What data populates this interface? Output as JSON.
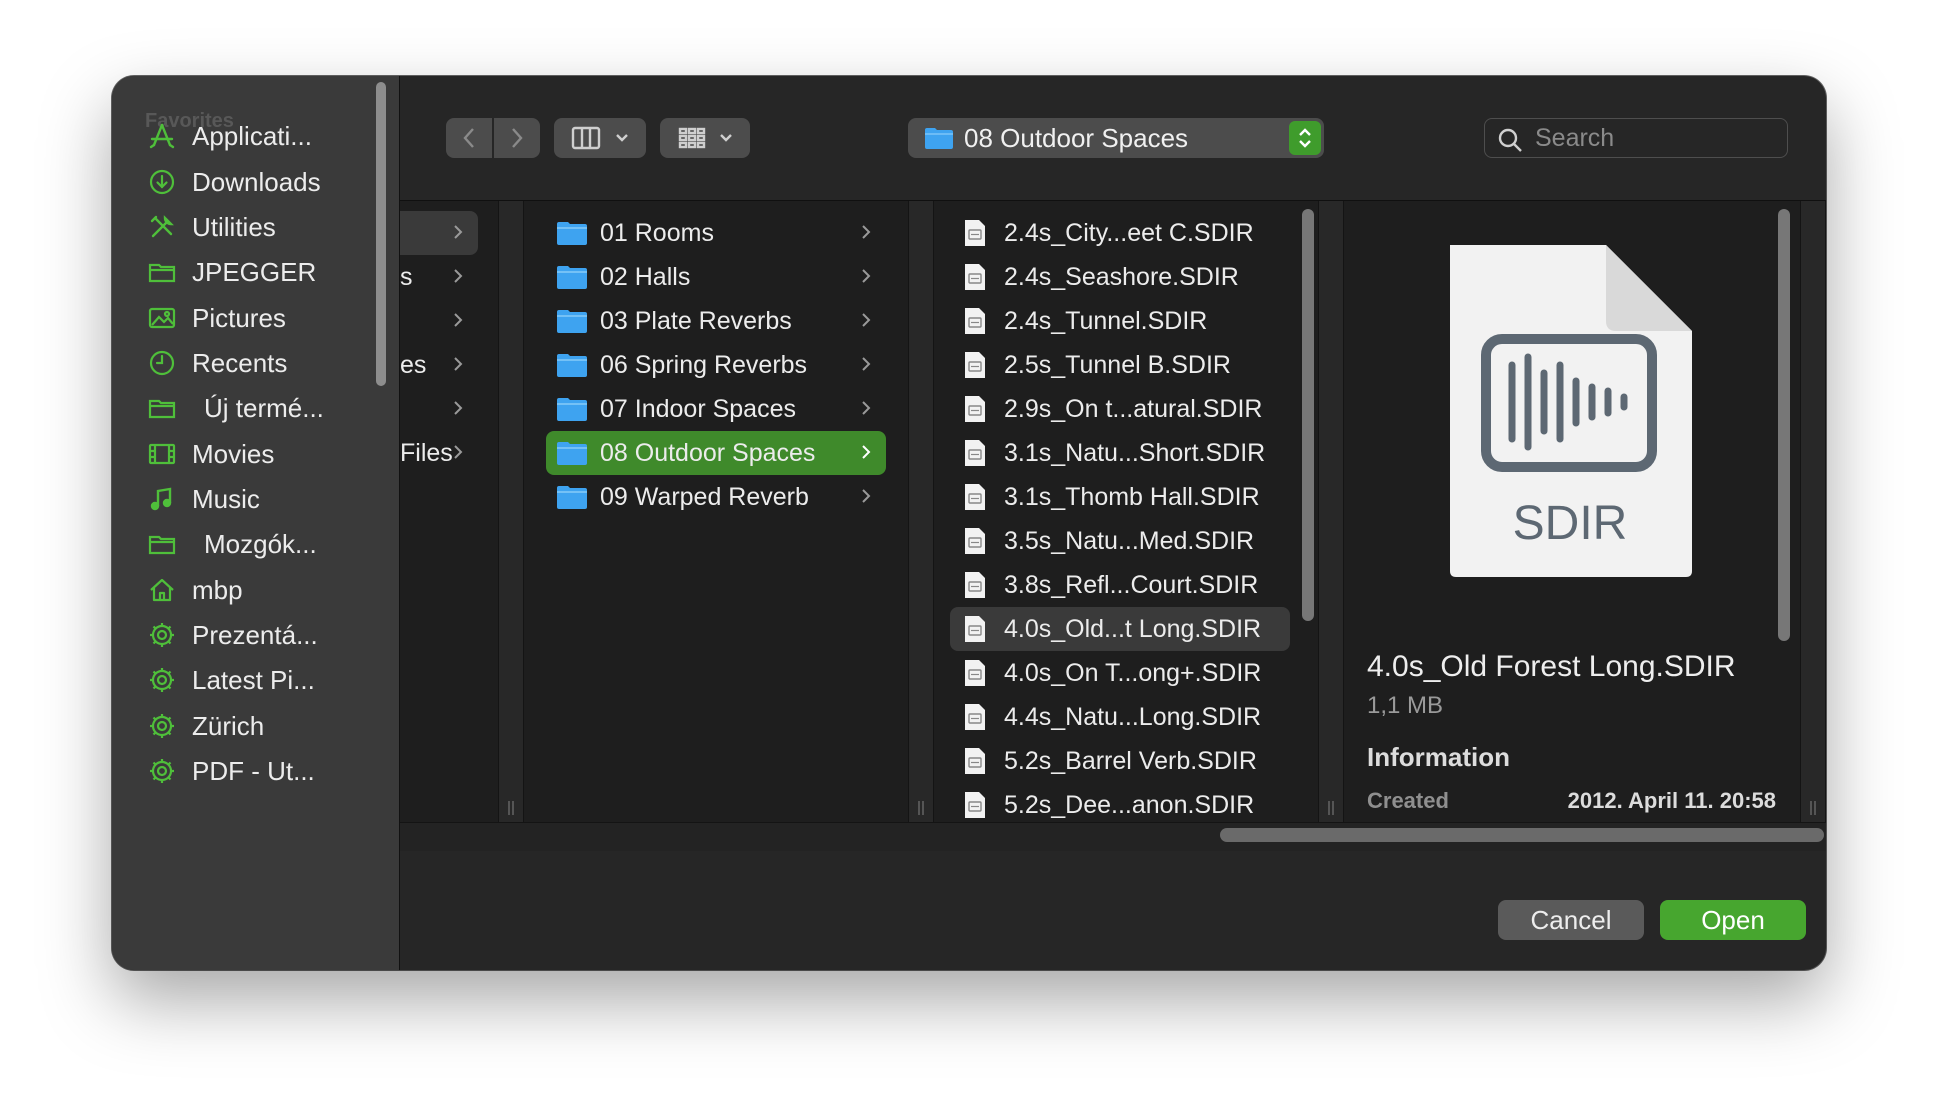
{
  "sidebar": {
    "header": "Favorites",
    "items": [
      {
        "label": "Applicati...",
        "icon": "applications-icon"
      },
      {
        "label": "Downloads",
        "icon": "downloads-icon"
      },
      {
        "label": "Utilities",
        "icon": "utilities-icon"
      },
      {
        "label": "JPEGGER",
        "icon": "folder-icon"
      },
      {
        "label": "Pictures",
        "icon": "pictures-icon"
      },
      {
        "label": "Recents",
        "icon": "recents-icon"
      },
      {
        "label": "Új termé...",
        "icon": "folder-icon"
      },
      {
        "label": "Movies",
        "icon": "movies-icon"
      },
      {
        "label": "Music",
        "icon": "music-icon"
      },
      {
        "label": "Mozgók...",
        "icon": "folder-icon"
      },
      {
        "label": "mbp",
        "icon": "home-icon"
      },
      {
        "label": "Prezentá...",
        "icon": "gear-icon"
      },
      {
        "label": "Latest Pi...",
        "icon": "gear-icon"
      },
      {
        "label": "Zürich",
        "icon": "gear-icon"
      },
      {
        "label": "PDF - Ut...",
        "icon": "gear-icon"
      }
    ]
  },
  "toolbar": {
    "path": "08 Outdoor Spaces",
    "search_placeholder": "Search"
  },
  "column1": {
    "partial_items": [
      "",
      "s",
      "",
      "es",
      "",
      "Files"
    ]
  },
  "column2": {
    "items": [
      "01 Rooms",
      "02 Halls",
      "03 Plate Reverbs",
      "06 Spring Reverbs",
      "07 Indoor Spaces",
      "08 Outdoor Spaces",
      "09 Warped Reverb"
    ],
    "selected": "08 Outdoor Spaces"
  },
  "column3": {
    "items": [
      "2.4s_City...eet C.SDIR",
      "2.4s_Seashore.SDIR",
      "2.4s_Tunnel.SDIR",
      "2.5s_Tunnel B.SDIR",
      "2.9s_On t...atural.SDIR",
      "3.1s_Natu...Short.SDIR",
      "3.1s_Thomb Hall.SDIR",
      "3.5s_Natu...Med.SDIR",
      "3.8s_Refl...Court.SDIR",
      "4.0s_Old...t Long.SDIR",
      "4.0s_On T...ong+.SDIR",
      "4.4s_Natu...Long.SDIR",
      "5.2s_Barrel Verb.SDIR",
      "5.2s_Dee...anon.SDIR"
    ],
    "selected": "4.0s_Old...t Long.SDIR"
  },
  "preview": {
    "icon_label": "SDIR",
    "filename": "4.0s_Old Forest Long.SDIR",
    "size": "1,1 MB",
    "info_header": "Information",
    "created_label": "Created",
    "created_value": "2012. April 11. 20:58"
  },
  "buttons": {
    "cancel": "Cancel",
    "open": "Open"
  },
  "colors": {
    "accent": "#47a62f",
    "selection": "#3f8a2b",
    "folder": "#3ea3f0",
    "window_bg": "#262626"
  }
}
